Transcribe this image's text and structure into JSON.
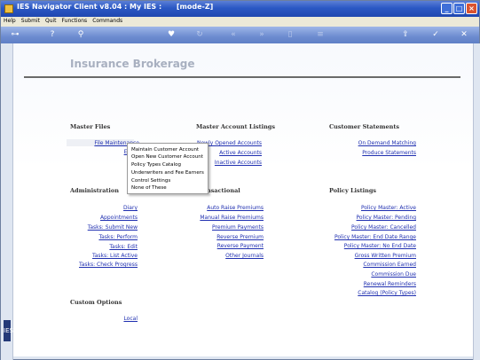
{
  "window": {
    "title": "IES Navigator Client v8.04 : My IES :      [mode-Z]"
  },
  "menubar": {
    "items": [
      "Help",
      "Submit",
      "Quit",
      "Functions",
      "Commands"
    ]
  },
  "page": {
    "title": "Insurance Brokerage"
  },
  "sections": {
    "master_files": {
      "heading": "Master Files",
      "links": [
        "File Maintenance",
        "End"
      ]
    },
    "master_account_listings": {
      "heading": "Master Account Listings",
      "links": [
        "Newly Opened Accounts",
        "Active Accounts",
        "Inactive Accounts"
      ]
    },
    "customer_statements": {
      "heading": "Customer Statements",
      "links": [
        "On Demand Matching",
        "Produce Statements"
      ]
    },
    "administration": {
      "heading": "Administration",
      "links": [
        "Diary",
        "Appointments",
        "Tasks: Submit New",
        "Tasks: Perform",
        "Tasks: Edit",
        "Tasks: List Active",
        "Tasks: Check Progress"
      ]
    },
    "transactional": {
      "heading": "nsactional",
      "links": [
        "Auto Raise Premiums",
        "Manual Raise Premiums",
        "Premium Payments",
        "Reverse Premium",
        "Reverse Payment",
        "Other Journals"
      ]
    },
    "policy_listings": {
      "heading": "Policy Listings",
      "links": [
        "Policy Master: Active",
        "Policy Master: Pending",
        "Policy Master: Cancelled",
        "Policy Master: End Date Range",
        "Policy Master: No End Date",
        "Gross Written Premium",
        "Commission Earned",
        "Commission Due",
        "Renewal Reminders",
        "Catalog (Policy Types)"
      ]
    },
    "custom_options": {
      "heading": "Custom Options",
      "links": [
        "Local"
      ]
    }
  },
  "popup_menu": {
    "items": [
      "Maintain Customer Account",
      "Open New Customer Account",
      "Policy Types Catalog",
      "Underwriters and Fee Earners",
      "Control Settings",
      "None of These"
    ]
  },
  "left_badge": "IES"
}
